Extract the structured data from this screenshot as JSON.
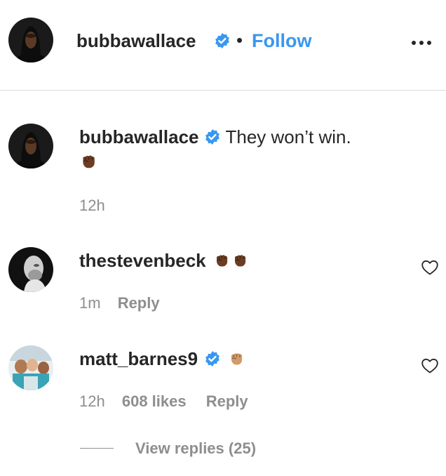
{
  "header": {
    "username": "bubbawallace",
    "separator": "•",
    "follow_label": "Follow",
    "more_icon": "more-horizontal-icon",
    "verified_color": "#3897f0",
    "follow_color": "#3897f0"
  },
  "caption": {
    "username": "bubbawallace",
    "text": "They won’t win.",
    "emoji": "raised-fist-dark-skin",
    "time": "12h"
  },
  "comments": [
    {
      "username": "thestevenbeck",
      "emoji_count": 2,
      "time": "1m",
      "reply_label": "Reply"
    },
    {
      "username": "matt_barnes9",
      "emoji_count": 1,
      "time": "12h",
      "likes": "608 likes",
      "reply_label": "Reply",
      "view_replies": "View replies (25)"
    }
  ],
  "colors": {
    "text": "#262626",
    "muted": "#8e8e8e",
    "border": "#dbdbdb"
  }
}
